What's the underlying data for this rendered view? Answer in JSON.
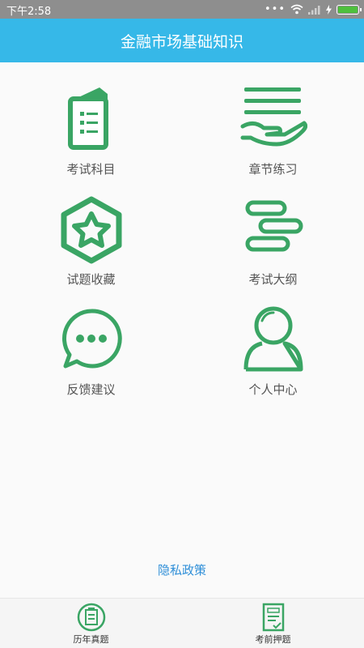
{
  "status_bar": {
    "time": "下午2:58",
    "dots": "•••"
  },
  "app": {
    "title": "金融市场基础知识"
  },
  "grid": [
    {
      "label": "考试科目",
      "icon": "book-list-icon"
    },
    {
      "label": "章节练习",
      "icon": "hand-lines-icon"
    },
    {
      "label": "试题收藏",
      "icon": "hexagon-star-icon"
    },
    {
      "label": "考试大纲",
      "icon": "outline-bars-icon"
    },
    {
      "label": "反馈建议",
      "icon": "chat-bubble-icon"
    },
    {
      "label": "个人中心",
      "icon": "user-icon"
    }
  ],
  "privacy_link": "隐私政策",
  "bottom_nav": [
    {
      "label": "历年真题",
      "icon": "exam-paper-circle-icon"
    },
    {
      "label": "考前押题",
      "icon": "score-sheet-icon"
    }
  ],
  "colors": {
    "primary_green": "#3aa564",
    "title_bar": "#36b8e8",
    "link": "#2f8fd8",
    "battery": "#4ec03d"
  }
}
